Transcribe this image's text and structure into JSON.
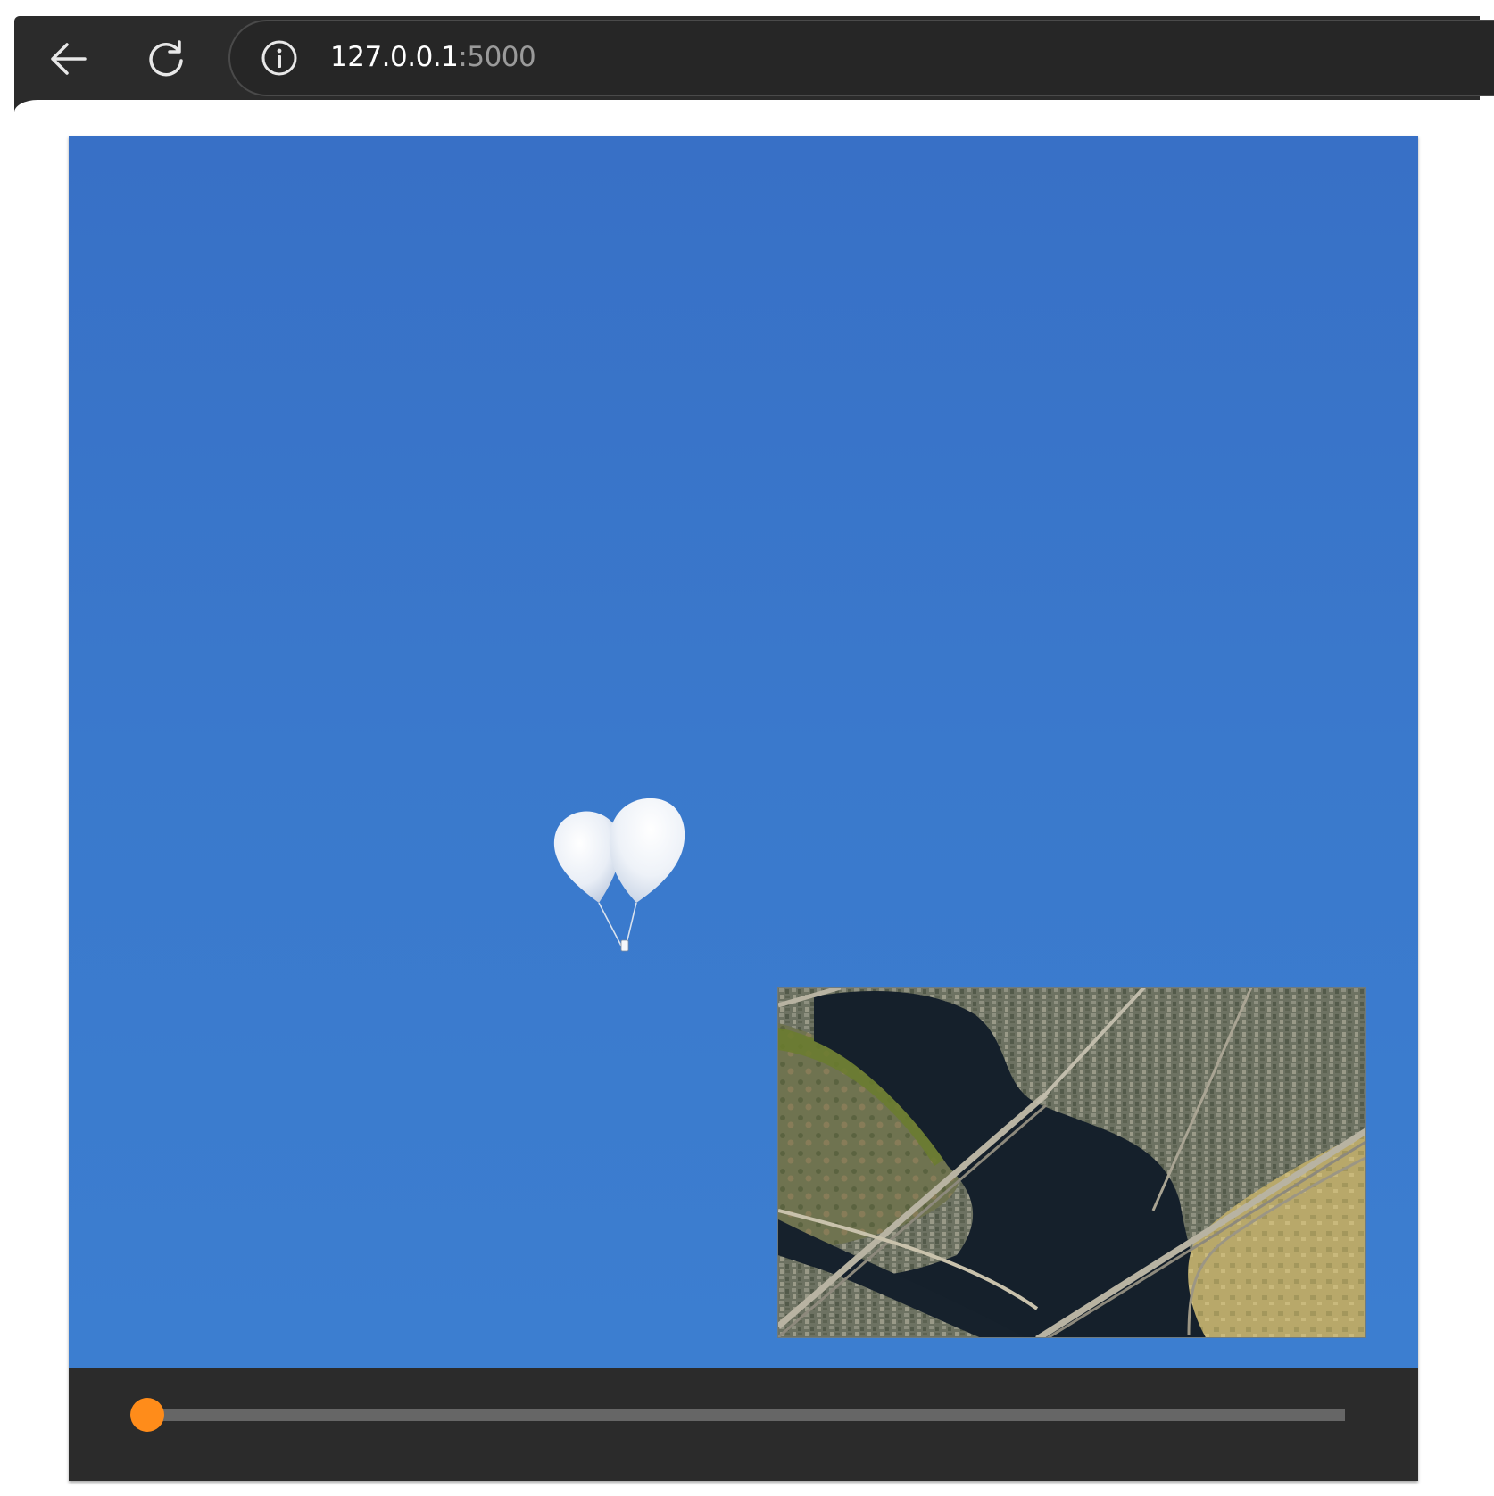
{
  "browser": {
    "url_host": "127.0.0.1",
    "url_port": ":5000",
    "icons": {
      "back": "arrow-left-icon",
      "reload": "reload-icon",
      "site_info": "info-circle-icon"
    }
  },
  "player": {
    "progress": 0.0,
    "colors": {
      "sky_top": "#3870c6",
      "sky_bottom": "#3c7ed0",
      "control_bar": "#2b2b2b",
      "seek_track": "#666666",
      "seek_accent": "#ff8c1a"
    },
    "video_subject": "balloon",
    "inset": "satellite-map"
  }
}
